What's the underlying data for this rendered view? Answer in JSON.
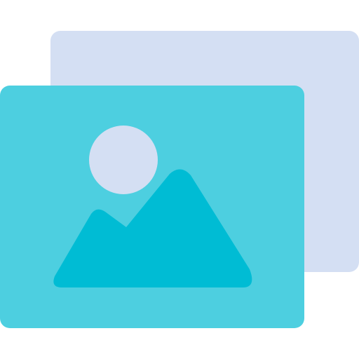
{
  "icon": {
    "name": "gallery-images-icon",
    "colors": {
      "back_card": "#D4DFF3",
      "front_card": "#4DCFE0",
      "sun": "#D4DFF3",
      "mountains": "#00BCD4"
    }
  }
}
